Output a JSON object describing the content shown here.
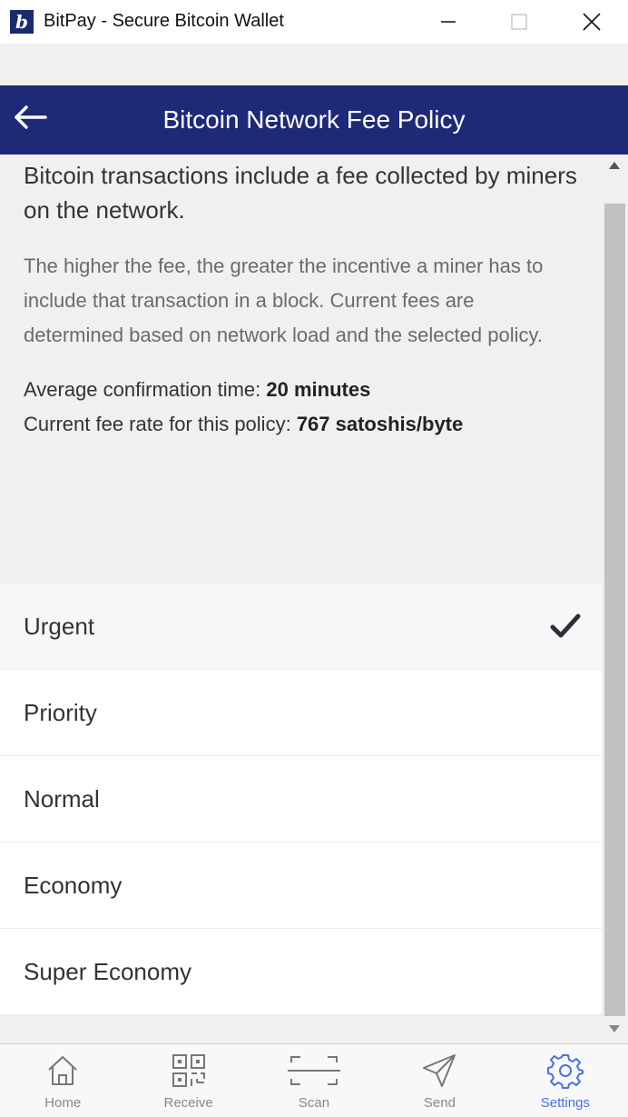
{
  "window": {
    "title": "BitPay - Secure Bitcoin Wallet",
    "logo_letter": "b"
  },
  "header": {
    "title": "Bitcoin Network Fee Policy"
  },
  "info": {
    "lead": "Bitcoin transactions include a fee collected by miners on the network.",
    "description": "The higher the fee, the greater the incentive a miner has to include that transaction in a block. Current fees are determined based on network load and the selected policy.",
    "confirmation_label": "Average confirmation time:",
    "confirmation_value": "20 minutes",
    "fee_rate_label": "Current fee rate for this policy:",
    "fee_rate_value": "767 satoshis/byte"
  },
  "options": [
    {
      "label": "Urgent",
      "selected": true
    },
    {
      "label": "Priority",
      "selected": false
    },
    {
      "label": "Normal",
      "selected": false
    },
    {
      "label": "Economy",
      "selected": false
    },
    {
      "label": "Super Economy",
      "selected": false
    }
  ],
  "tabs": [
    {
      "label": "Home",
      "icon": "home-icon"
    },
    {
      "label": "Receive",
      "icon": "qr-code-icon"
    },
    {
      "label": "Scan",
      "icon": "scan-icon"
    },
    {
      "label": "Send",
      "icon": "send-icon"
    },
    {
      "label": "Settings",
      "icon": "gear-icon",
      "active": true
    }
  ],
  "colors": {
    "header_bg": "#1e2a78",
    "accent": "#4c6ee8",
    "logo_bg": "#1a2b6d"
  }
}
